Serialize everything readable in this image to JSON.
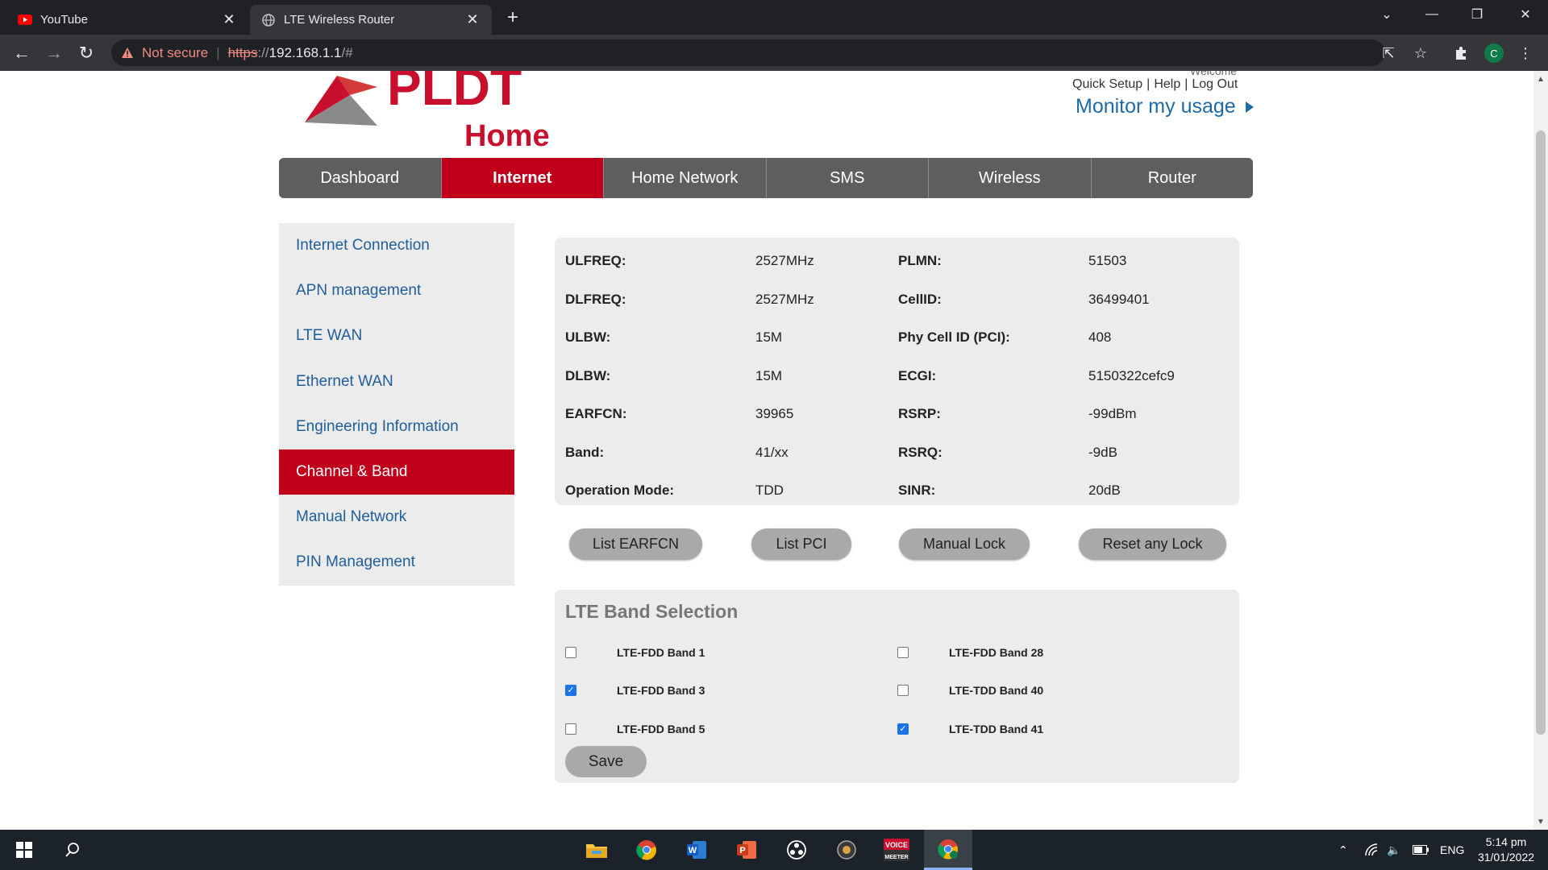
{
  "browser": {
    "tabs": [
      {
        "title": "YouTube",
        "active": false
      },
      {
        "title": "LTE Wireless Router",
        "active": true
      }
    ],
    "address": {
      "security": "Not secure",
      "scheme": "https",
      "separator": "://",
      "host": "192.168.1.1",
      "path": "/#"
    },
    "profile_initial": "C"
  },
  "header": {
    "logo_text": "PLDT",
    "logo_sub": "Home",
    "welcome": "Welcome",
    "links": [
      "Quick Setup",
      "Help",
      "Log Out"
    ],
    "monitor": "Monitor my usage"
  },
  "mainnav": {
    "items": [
      "Dashboard",
      "Internet",
      "Home Network",
      "SMS",
      "Wireless",
      "Router"
    ],
    "active": "Internet"
  },
  "sidebar": {
    "items": [
      "Internet Connection",
      "APN management",
      "LTE WAN",
      "Ethernet WAN",
      "Engineering Information",
      "Channel & Band",
      "Manual Network",
      "PIN Management"
    ],
    "active": "Channel & Band"
  },
  "info": {
    "rows": [
      {
        "k1": "ULFREQ:",
        "v1": "2527MHz",
        "k2": "PLMN:",
        "v2": "51503"
      },
      {
        "k1": "DLFREQ:",
        "v1": "2527MHz",
        "k2": "CellID:",
        "v2": "36499401"
      },
      {
        "k1": "ULBW:",
        "v1": "15M",
        "k2": "Phy Cell ID (PCI):",
        "v2": "408"
      },
      {
        "k1": "DLBW:",
        "v1": "15M",
        "k2": "ECGI:",
        "v2": "5150322cefc9"
      },
      {
        "k1": "EARFCN:",
        "v1": "39965",
        "k2": "RSRP:",
        "v2": "-99dBm"
      },
      {
        "k1": "Band:",
        "v1": "41/xx",
        "k2": "RSRQ:",
        "v2": "-9dB"
      },
      {
        "k1": "Operation Mode:",
        "v1": "TDD",
        "k2": "SINR:",
        "v2": "20dB"
      }
    ]
  },
  "actions": {
    "list_earfcn": "List EARFCN",
    "list_pci": "List PCI",
    "manual_lock": "Manual Lock",
    "reset_lock": "Reset any Lock"
  },
  "bands": {
    "title": "LTE Band Selection",
    "items": [
      {
        "label": "LTE-FDD Band 1",
        "checked": false
      },
      {
        "label": "LTE-FDD Band 28",
        "checked": false
      },
      {
        "label": "LTE-FDD Band 3",
        "checked": true
      },
      {
        "label": "LTE-TDD Band 40",
        "checked": false
      },
      {
        "label": "LTE-FDD Band 5",
        "checked": false
      },
      {
        "label": "LTE-TDD Band 41",
        "checked": true
      }
    ],
    "save": "Save"
  },
  "taskbar": {
    "tray_lang": "ENG",
    "time": "5:14 pm",
    "date": "31/01/2022",
    "voicemeeter_line1": "VOICE",
    "voicemeeter_line2": "MEETER"
  },
  "colors": {
    "brand_red": "#c0001a",
    "link_blue": "#1e5e9a",
    "nav_gray": "#5e5e5e"
  }
}
